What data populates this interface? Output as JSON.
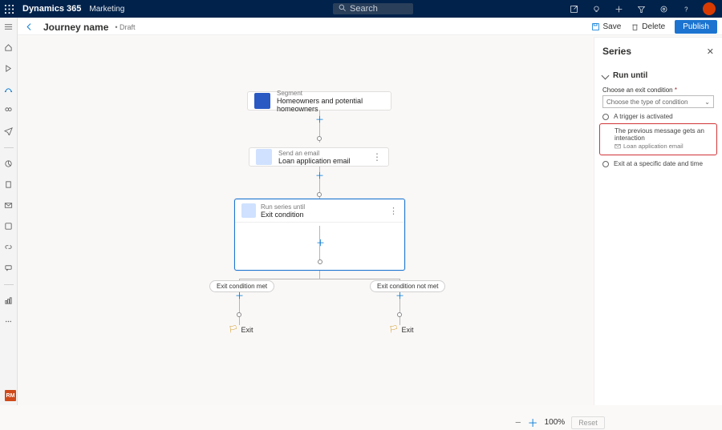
{
  "app": {
    "name": "Dynamics 365",
    "module": "Marketing",
    "search_placeholder": "Search"
  },
  "header": {
    "back": "Back",
    "title": "Journey name",
    "status": "• Draft",
    "save": "Save",
    "delete": "Delete",
    "publish": "Publish"
  },
  "canvas": {
    "segment": {
      "tag": "Segment",
      "name": "Homeowners and potential homeowners"
    },
    "email": {
      "tag": "Send an email",
      "name": "Loan application email"
    },
    "series": {
      "tag": "Run series until",
      "name": "Exit condition"
    },
    "branch_met": "Exit condition met",
    "branch_notmet": "Exit condition not met",
    "exit_label": "Exit",
    "zoom": {
      "pct": "100%",
      "reset": "Reset"
    }
  },
  "panel": {
    "title": "Series",
    "section": "Run until",
    "field_label": "Choose an exit condition",
    "field_required": "*",
    "select_placeholder": "Choose the type of condition",
    "opts": {
      "trigger": "A trigger is activated",
      "interaction": "The previous message gets an interaction",
      "interaction_sub": "Loan application email",
      "time": "Exit at a specific date and time"
    }
  },
  "rm": "RM"
}
